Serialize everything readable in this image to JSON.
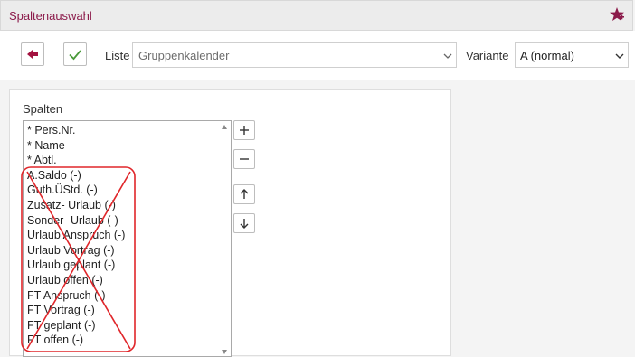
{
  "window": {
    "title": "Spaltenauswahl",
    "pin_icon": "pin-star-icon"
  },
  "toolbar": {
    "back_icon": "arrow-left-icon",
    "confirm_icon": "checkmark-icon",
    "list_label": "Liste",
    "list_value": "Gruppenkalender",
    "variant_label": "Variante",
    "variant_value": "A (normal)"
  },
  "columns_panel": {
    "heading": "Spalten",
    "items": [
      "* Pers.Nr.",
      "* Name",
      "* Abtl.",
      "A.Saldo (-)",
      "Guth.ÜStd. (-)",
      "Zusatz- Urlaub (-)",
      "Sonder- Urlaub (-)",
      "Urlaub Anspruch (-)",
      "Urlaub Vortrag (-)",
      "Urlaub geplant (-)",
      "Urlaub offen (-)",
      "FT Anspruch (-)",
      "FT Vortrag (-)",
      "FT geplant (-)",
      "FT offen (-)"
    ],
    "buttons": {
      "add": "+",
      "remove": "−",
      "up": "↑",
      "down": "↓"
    }
  },
  "colors": {
    "accent": "#8b1a4a",
    "confirm": "#4a9a3a",
    "annotation": "#e0262a"
  }
}
